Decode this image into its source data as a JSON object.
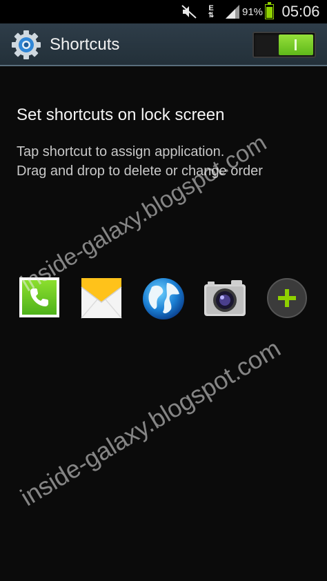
{
  "status_bar": {
    "data_indicator": "E",
    "battery_percent": "91%",
    "battery_level": 0.91,
    "time": "05:06",
    "icons": [
      "mute-icon",
      "data-activity-icon",
      "signal-icon",
      "battery-icon"
    ]
  },
  "action_bar": {
    "title": "Shortcuts",
    "icon": "settings-gear-icon",
    "toggle_state": "on"
  },
  "content": {
    "heading": "Set shortcuts on lock screen",
    "description_line1": "Tap shortcut to assign application.",
    "description_line2": "Drag and drop to delete or change order"
  },
  "shortcuts": [
    {
      "name": "phone",
      "icon": "phone-icon"
    },
    {
      "name": "email",
      "icon": "email-icon"
    },
    {
      "name": "internet",
      "icon": "globe-icon"
    },
    {
      "name": "camera",
      "icon": "camera-icon"
    },
    {
      "name": "add",
      "icon": "plus-icon"
    }
  ],
  "watermark": {
    "text_1": "inside-galaxy.blogspot.com",
    "text_2": "inside-galaxy.blogspot.com"
  },
  "colors": {
    "accent_green": "#8fd100",
    "action_bar": "#2e3d49",
    "background": "#0b0b0b"
  }
}
